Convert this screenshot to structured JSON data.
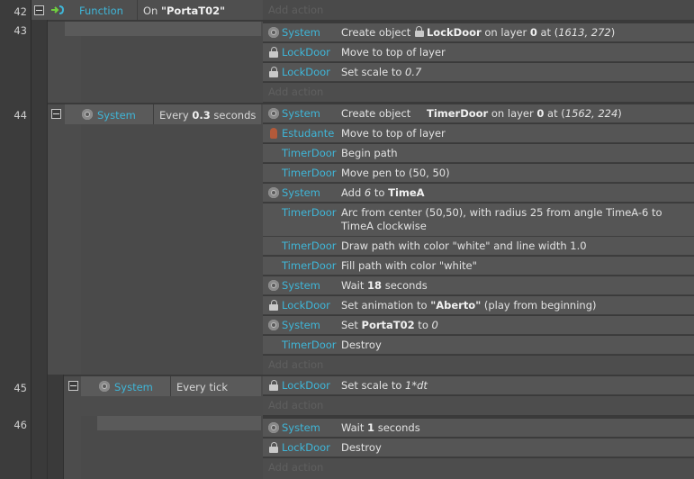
{
  "rows": [
    {
      "num": "42",
      "function_label": "Function",
      "event_text": "On ",
      "event_name": "\"PortaT02\"",
      "add_action": "Add action"
    },
    {
      "num": "43"
    },
    {
      "num": "44",
      "cond_object": "System",
      "cond_text": "Every ",
      "cond_value": "0.3",
      "cond_suffix": " seconds"
    },
    {
      "num": "45",
      "cond_object": "System",
      "cond_text": "Every tick"
    },
    {
      "num": "46"
    }
  ],
  "actions_43": [
    {
      "icon": "gear-icon",
      "object": "System",
      "pre": "Create object ",
      "lock": true,
      "bold1": "LockDoor",
      "mid": " on layer ",
      "bold2": "0",
      "post": " at (",
      "ital": "1613, 272",
      "end": ")"
    },
    {
      "icon": "lock-icon",
      "object": "LockDoor",
      "text": "Move to top of layer"
    },
    {
      "icon": "lock-icon",
      "object": "LockDoor",
      "pre": "Set scale to ",
      "ital": "0.7"
    }
  ],
  "actions_44": [
    {
      "icon": "gear-icon",
      "object": "System",
      "pre": "Create object ",
      "bold1": "TimerDoor",
      "mid": " on layer ",
      "bold2": "0",
      "post": " at (",
      "ital": "1562, 224",
      "end": ")"
    },
    {
      "icon": "person-icon",
      "object": "Estudante",
      "text": "Move to top of layer"
    },
    {
      "icon": "",
      "object": "TimerDoor",
      "text": "Begin path"
    },
    {
      "icon": "",
      "object": "TimerDoor",
      "text": "Move pen to (50, 50)"
    },
    {
      "icon": "gear-icon",
      "object": "System",
      "pre": "Add ",
      "ital": "6",
      "mid": " to ",
      "bold1": "TimeA"
    },
    {
      "icon": "",
      "object": "TimerDoor",
      "text": "Arc from center (50,50), with radius 25 from angle TimeA-6 to TimeA clockwise"
    },
    {
      "icon": "",
      "object": "TimerDoor",
      "text": "Draw path with color \"white\" and line width 1.0"
    },
    {
      "icon": "",
      "object": "TimerDoor",
      "text": "Fill path with color \"white\""
    },
    {
      "icon": "gear-icon",
      "object": "System",
      "pre": "Wait ",
      "bold1": "18",
      "post": " seconds"
    },
    {
      "icon": "lock-icon",
      "object": "LockDoor",
      "pre": "Set animation to ",
      "bold1": "\"Aberto\"",
      "post": " (play from beginning)"
    },
    {
      "icon": "gear-icon",
      "object": "System",
      "pre": "Set ",
      "bold1": "PortaT02",
      "mid": " to ",
      "ital": "0"
    },
    {
      "icon": "",
      "object": "TimerDoor",
      "text": "Destroy"
    }
  ],
  "actions_45": [
    {
      "icon": "lock-icon",
      "object": "LockDoor",
      "pre": "Set scale to ",
      "ital": "1*dt"
    }
  ],
  "actions_46": [
    {
      "icon": "gear-icon",
      "object": "System",
      "pre": "Wait ",
      "bold1": "1",
      "post": " seconds"
    },
    {
      "icon": "lock-icon",
      "object": "LockDoor",
      "text": "Destroy"
    }
  ],
  "add_action_label": "Add action",
  "colors": {
    "object_link": "#3fb6d8",
    "background": "#3a3a3a",
    "action_row": "#555555",
    "function_arrow": "#6fcf3f"
  }
}
